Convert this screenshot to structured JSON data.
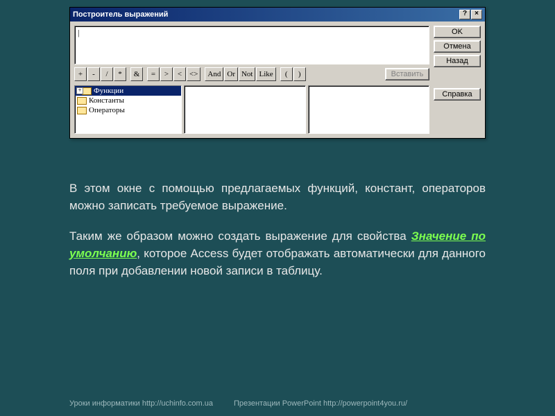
{
  "dialog": {
    "title": "Построитель выражений",
    "help_btn": "?",
    "close_btn": "×",
    "expression_value": "|",
    "buttons": {
      "ok": "OK",
      "cancel": "Отмена",
      "back": "Назад",
      "help": "Справка",
      "insert": "Вставить"
    },
    "operators": {
      "plus": "+",
      "minus": "-",
      "div": "/",
      "mul": "*",
      "amp": "&",
      "eq": "=",
      "gt": ">",
      "lt": "<",
      "ne": "<>",
      "and": "And",
      "or": "Or",
      "not": "Not",
      "like": "Like",
      "lparen": "(",
      "rparen": ")"
    },
    "tree": {
      "item0": "Функции",
      "item1": "Константы",
      "item2": "Операторы"
    }
  },
  "description": {
    "p1": "В этом окне с помощью предлагаемых функций, констант, операторов можно записать требуемое выражение.",
    "p2a": "Таким же образом можно создать выражение для свойства ",
    "p2_term": "Значение по умолчанию",
    "p2b": ", которое Access будет отображать автоматически для данного поля при добавлении новой записи в таблицу."
  },
  "footer": {
    "left": "Уроки информатики  http://uchinfo.com.ua",
    "right": "Презентации PowerPoint  http://powerpoint4you.ru/"
  }
}
